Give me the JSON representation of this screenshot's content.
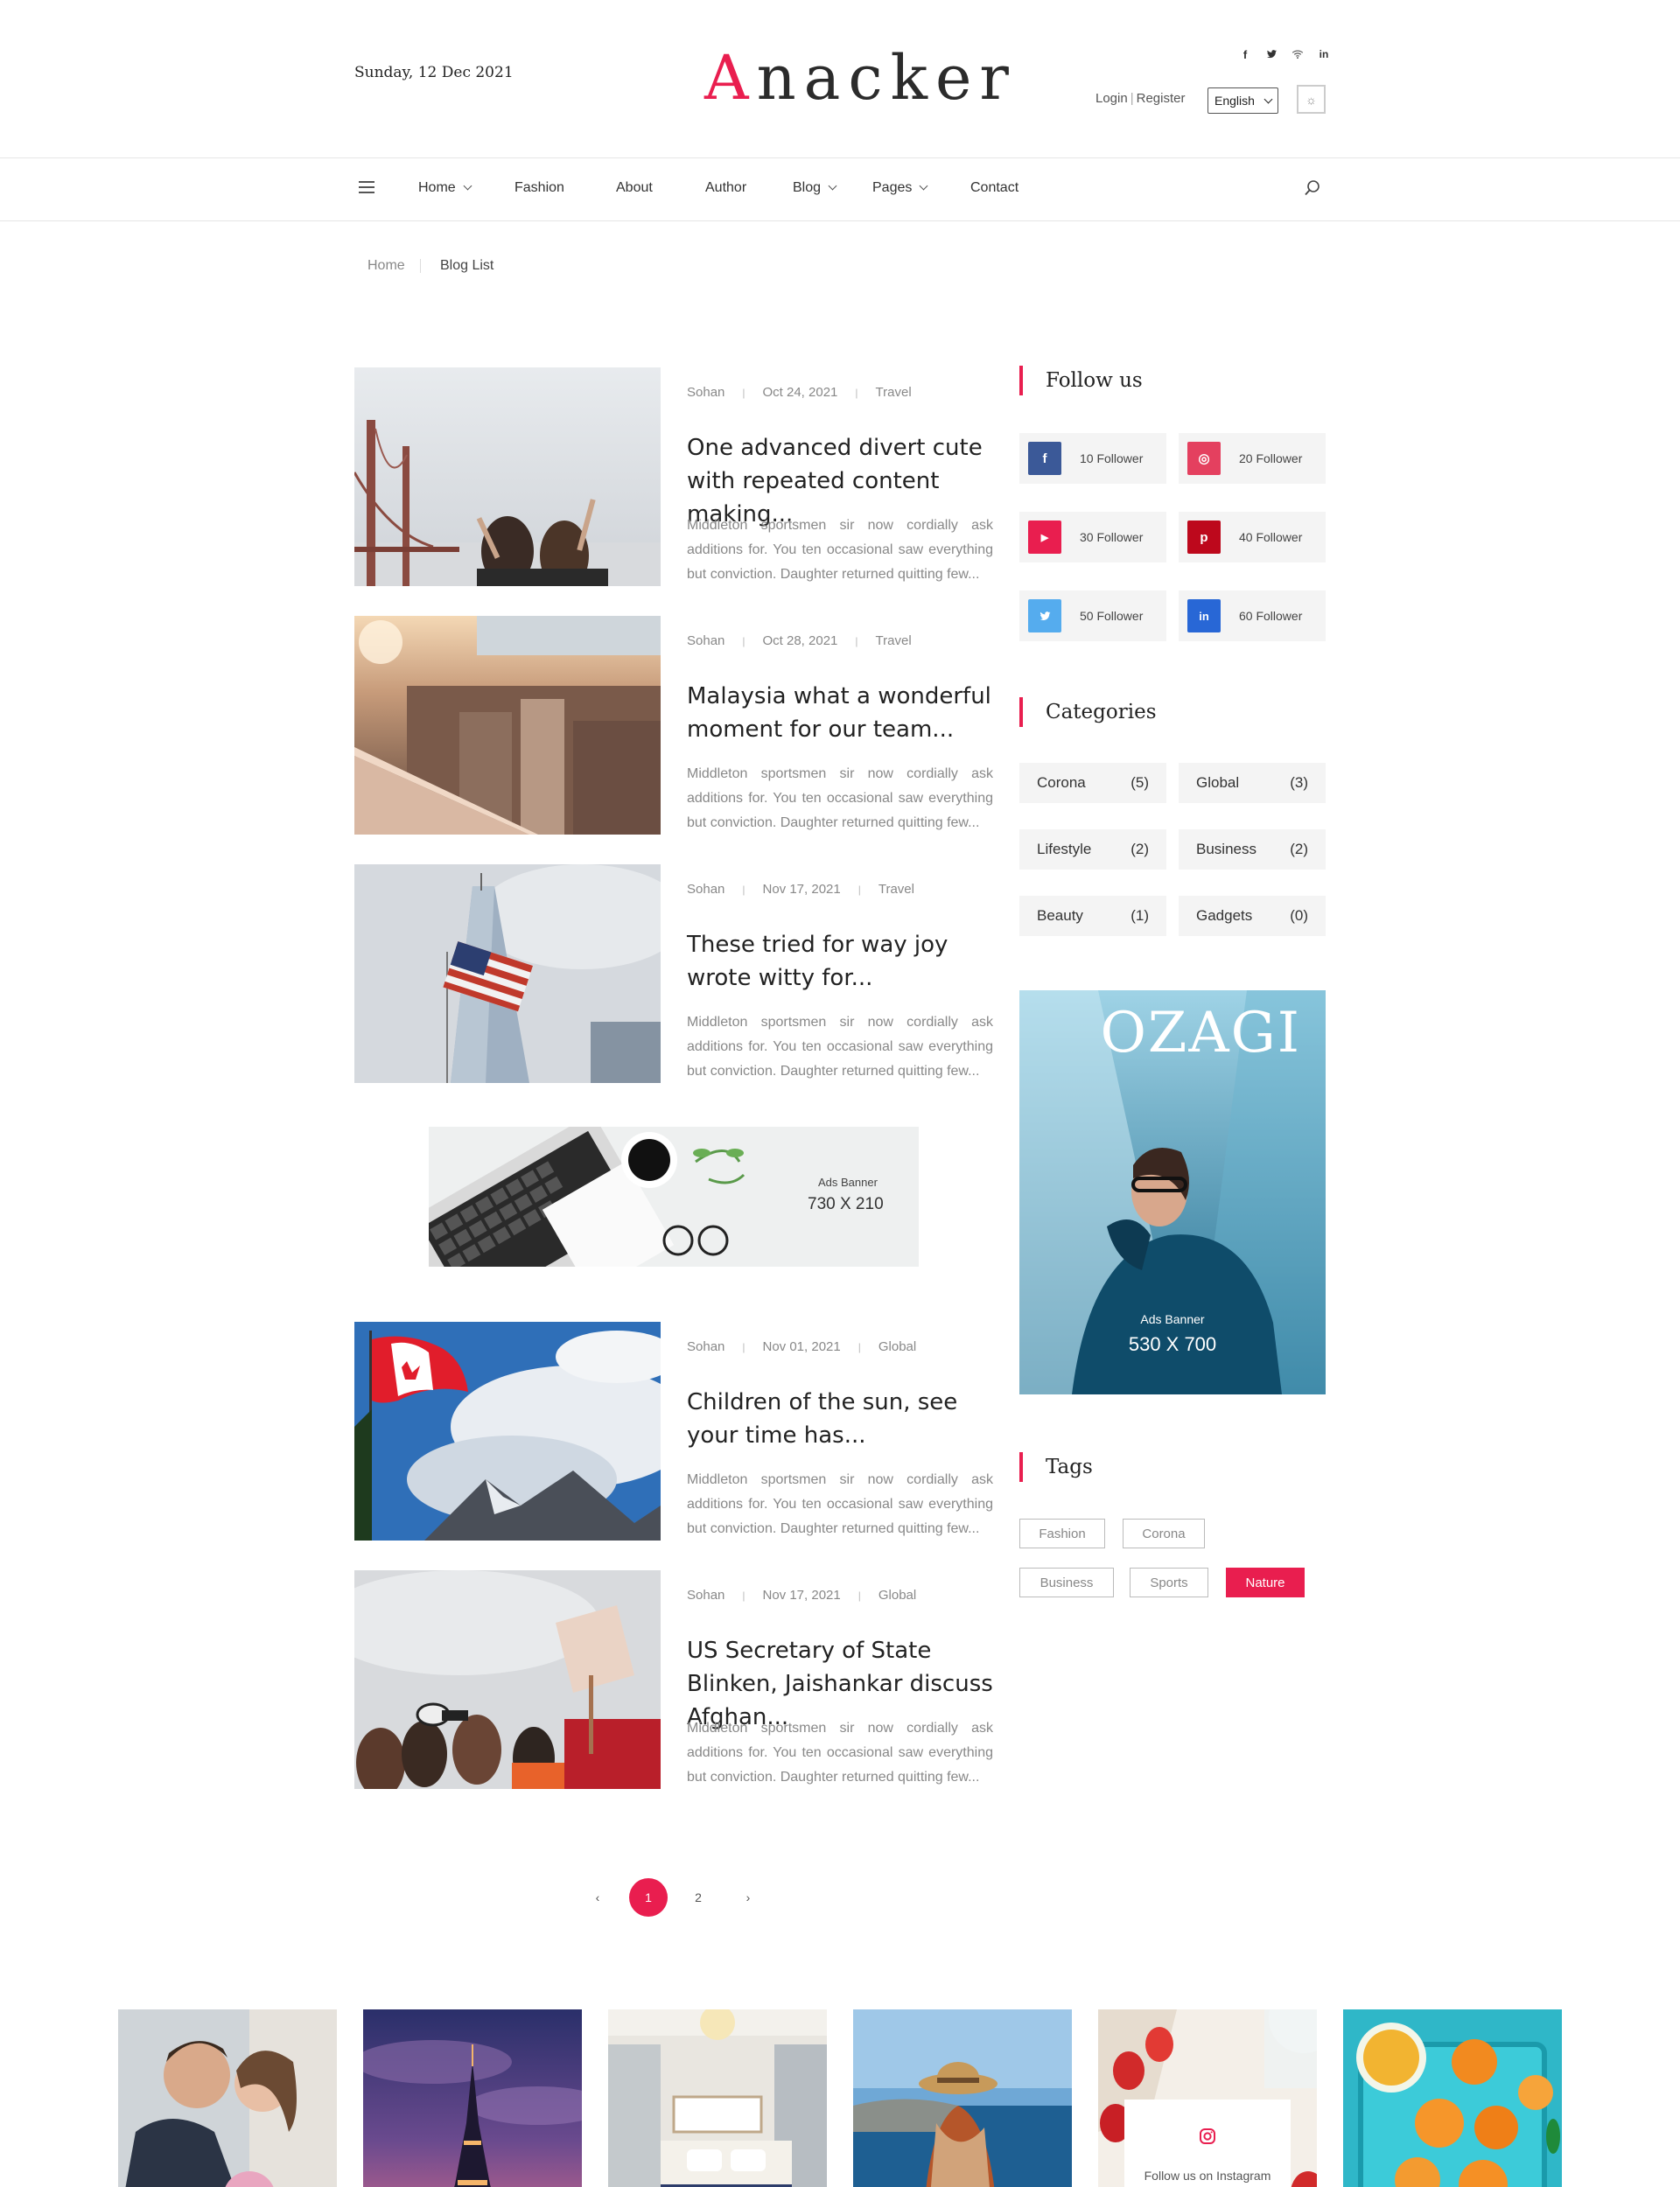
{
  "header": {
    "date": "Sunday, 12 Dec 2021",
    "logo": "Anacker",
    "social_icons": [
      "facebook-icon",
      "twitter-icon",
      "wifi-icon",
      "linkedin-icon"
    ],
    "login": "Login",
    "register": "Register",
    "language": "English",
    "theme_toggle_icon": "sun-icon"
  },
  "nav": {
    "items": [
      {
        "label": "Home",
        "dropdown": true
      },
      {
        "label": "Fashion",
        "dropdown": false
      },
      {
        "label": "About",
        "dropdown": false
      },
      {
        "label": "Author",
        "dropdown": false
      },
      {
        "label": "Blog",
        "dropdown": true
      },
      {
        "label": "Pages",
        "dropdown": true
      },
      {
        "label": "Contact",
        "dropdown": false
      }
    ],
    "search_icon": "search-icon"
  },
  "breadcrumb": {
    "home": "Home",
    "current": "Blog List"
  },
  "posts": [
    {
      "author": "Sohan",
      "date": "Oct 24, 2021",
      "category": "Travel",
      "title": "One advanced divert cute with repeated content making...",
      "excerpt": "Middleton sportsmen sir now cordially ask additions for. You ten occasional saw everything but conviction. Daughter returned quitting few..."
    },
    {
      "author": "Sohan",
      "date": "Oct 28, 2021",
      "category": "Travel",
      "title": "Malaysia what a wonderful moment for our team...",
      "excerpt": "Middleton sportsmen sir now cordially ask additions for. You ten occasional saw everything but conviction. Daughter returned quitting few..."
    },
    {
      "author": "Sohan",
      "date": "Nov 17, 2021",
      "category": "Travel",
      "title": "These tried for way joy wrote witty for...",
      "excerpt": "Middleton sportsmen sir now cordially ask additions for. You ten occasional saw everything but conviction. Daughter returned quitting few..."
    },
    {
      "author": "Sohan",
      "date": "Nov 01, 2021",
      "category": "Global",
      "title": "Children of the sun, see your time has...",
      "excerpt": "Middleton sportsmen sir now cordially ask additions for. You ten occasional saw everything but conviction. Daughter returned quitting few..."
    },
    {
      "author": "Sohan",
      "date": "Nov 17, 2021",
      "category": "Global",
      "title": "US Secretary of State Blinken, Jaishankar discuss Afghan...",
      "excerpt": "Middleton sportsmen sir now cordially ask additions for. You ten occasional saw everything but conviction. Daughter returned quitting few..."
    }
  ],
  "ad_inline": {
    "label": "Ads Banner",
    "size": "730 X 210"
  },
  "sidebar": {
    "follow_title": "Follow us",
    "follow": [
      {
        "icon": "facebook-icon",
        "glyph": "f",
        "count": "10 Follower",
        "color": "#3b5998"
      },
      {
        "icon": "instagram-icon",
        "glyph": "◎",
        "count": "20 Follower",
        "color": "#e4405f"
      },
      {
        "icon": "youtube-icon",
        "glyph": "▶",
        "count": "30 Follower",
        "color": "#e91e4f"
      },
      {
        "icon": "pinterest-icon",
        "glyph": "p",
        "count": "40 Follower",
        "color": "#bd081c"
      },
      {
        "icon": "twitter-icon",
        "glyph": "t",
        "count": "50 Follower",
        "color": "#55acee"
      },
      {
        "icon": "linkedin-icon",
        "glyph": "in",
        "count": "60 Follower",
        "color": "#2867d6"
      }
    ],
    "categories_title": "Categories",
    "categories": [
      {
        "name": "Corona",
        "count": "(5)"
      },
      {
        "name": "Global",
        "count": "(3)"
      },
      {
        "name": "Lifestyle",
        "count": "(2)"
      },
      {
        "name": "Business",
        "count": "(2)"
      },
      {
        "name": "Beauty",
        "count": "(1)"
      },
      {
        "name": "Gadgets",
        "count": "(0)"
      }
    ],
    "ad": {
      "brand": "OZAGI",
      "label": "Ads Banner",
      "size": "530 X 700"
    },
    "tags_title": "Tags",
    "tags": [
      {
        "label": "Fashion",
        "active": false
      },
      {
        "label": "Corona",
        "active": false
      },
      {
        "label": "Business",
        "active": false
      },
      {
        "label": "Sports",
        "active": false
      },
      {
        "label": "Nature",
        "active": true
      }
    ]
  },
  "pagination": {
    "prev": "‹",
    "pages": [
      "1",
      "2"
    ],
    "current": "1",
    "next": "›"
  },
  "instagram": {
    "label": "Follow us on Instagram",
    "icon": "instagram-icon"
  },
  "colors": {
    "accent": "#e91e4f"
  }
}
